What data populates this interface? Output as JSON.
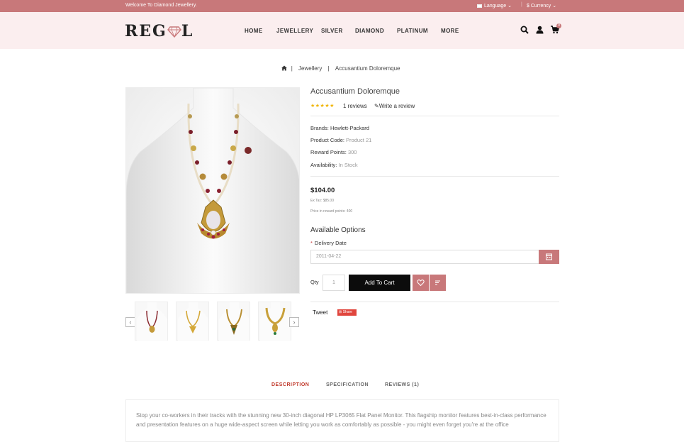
{
  "topbar": {
    "welcome": "Welcome To Diamond Jewellery.",
    "language": "Language",
    "currency": "$ Currency"
  },
  "header": {
    "logo_left": "REG",
    "logo_right": "L",
    "nav": [
      "HOME",
      "JEWELLERY",
      "SILVER",
      "DIAMOND",
      "PLATINUM",
      "MORE"
    ],
    "cart_count": "0",
    "accent": "#c8787a"
  },
  "breadcrumb": {
    "items": [
      "Jewellery",
      "Accusantium Doloremque"
    ],
    "separator": "|"
  },
  "product": {
    "title": "Accusantium Doloremque",
    "rating_stars": "★★★★★",
    "reviews": "1 reviews",
    "write_review": "Write a review",
    "brands_label": "Brands:",
    "brands_value": "Hewlett-Packard",
    "code_label": "Product Code:",
    "code_value": "Product 21",
    "points_label": "Reward Points:",
    "points_value": "300",
    "availability_label": "Availability:",
    "availability_value": "In Stock",
    "price": "$104.00",
    "ex_tax": "Ex Tax: $85.00",
    "price_points": "Price in reward points: 400",
    "options_title": "Available Options",
    "delivery_required": "*",
    "delivery_label": "Delivery Date",
    "delivery_value": "2011-04-22",
    "qty_label": "Qty",
    "qty_value": "1",
    "add_to_cart": "Add To Cart",
    "tweet": "Tweet",
    "share": "Share"
  },
  "tabs": [
    "DESCRIPTION",
    "SPECIFICATION",
    "REVIEWS (1)"
  ],
  "description": "Stop your co-workers in their tracks with the stunning new 30-inch diagonal HP LP3065 Flat Panel Monitor. This flagship monitor features best-in-class performance and presentation features on a huge wide-aspect screen while letting you work as comfortably as possible - you might even forget you're at the office"
}
